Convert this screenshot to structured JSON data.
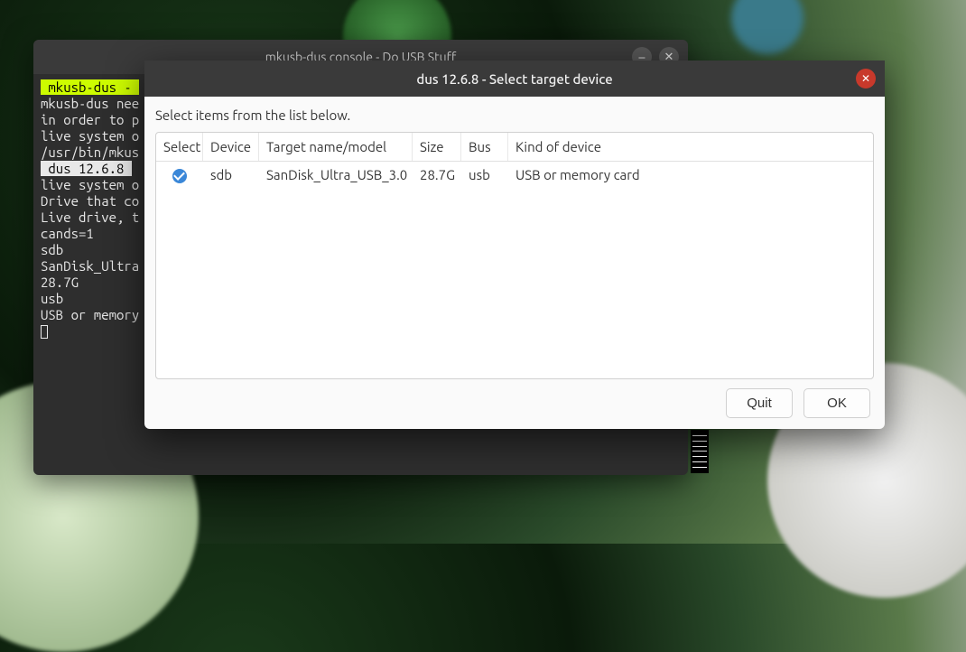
{
  "wallpaper": {
    "desc": "green illustrated creature artwork"
  },
  "terminal": {
    "title": "mkusb-dus console - Do USB Stuff",
    "lines": {
      "l0": " mkusb-dus - ",
      "l1": "mkusb-dus nee",
      "l2": "in order to p",
      "l3": "live system o",
      "l4": "/usr/bin/mkus",
      "l5": " dus 12.6.8 ",
      "l6": "live system o",
      "l7": "Drive that co",
      "l8": "Live drive, t",
      "l9": "cands=1",
      "l10": "sdb",
      "l11": "SanDisk_Ultra",
      "l12": "28.7G",
      "l13": "usb",
      "l14": "USB or memory"
    }
  },
  "dialog": {
    "title": "dus 12.6.8 - Select target device",
    "instruction": "Select items from the list below.",
    "headers": {
      "select": "Select",
      "device": "Device",
      "target": "Target name/model",
      "size": "Size",
      "bus": "Bus",
      "kind": "Kind of device"
    },
    "rows": [
      {
        "selected": true,
        "device": "sdb",
        "target": "SanDisk_Ultra_USB_3.0",
        "size": "28.7G",
        "bus": "usb",
        "kind": "USB or memory card"
      }
    ],
    "buttons": {
      "quit": "Quit",
      "ok": "OK"
    }
  }
}
